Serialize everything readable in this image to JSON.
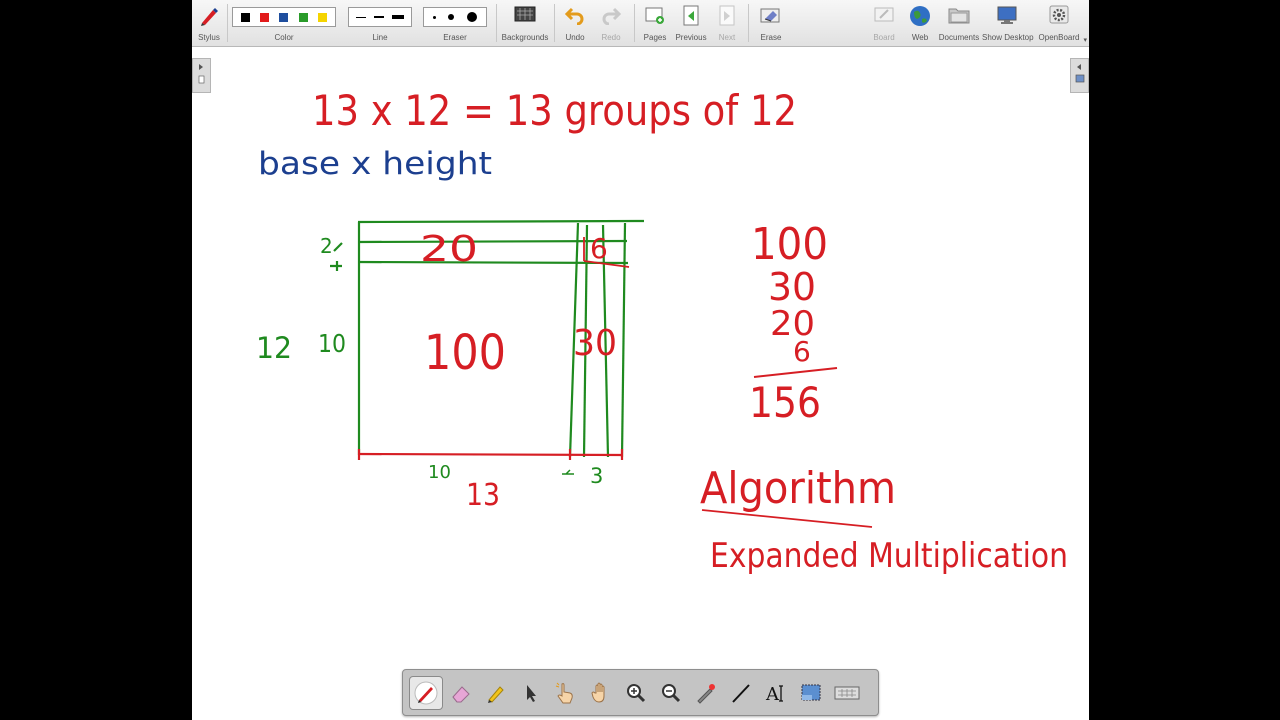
{
  "toolbar": {
    "stylus": "Stylus",
    "color": "Color",
    "line": "Line",
    "eraser": "Eraser",
    "backgrounds": "Backgrounds",
    "undo": "Undo",
    "redo": "Redo",
    "pages": "Pages",
    "previous": "Previous",
    "next": "Next",
    "erase": "Erase",
    "board": "Board",
    "web": "Web",
    "documents": "Documents",
    "show_desktop": "Show Desktop",
    "openboard": "OpenBoard"
  },
  "colors": {
    "swatches": [
      "#000000",
      "#e21b1b",
      "#1f4e9e",
      "#2a9b2a",
      "#f5d400"
    ],
    "ink_red": "#d61e24",
    "ink_blue": "#1c3f8f",
    "ink_green": "#1f8a1f"
  },
  "board": {
    "line1": "13 x 12 = 13 groups of 12",
    "line2": "base x height",
    "row_label_2": "2",
    "row_label_12": "12",
    "row_label_10": "10",
    "cell_20": "20",
    "cell_6": "6",
    "cell_100": "100",
    "cell_30": "30",
    "bottom_10": "10",
    "bottom_3": "3",
    "bottom_13": "13",
    "sum": [
      "100",
      "30",
      "20",
      "6"
    ],
    "total": "156",
    "algorithm": "Algorithm",
    "expanded": "Expanded Multiplication"
  },
  "palette_tools": [
    "pen-tool",
    "eraser-tool",
    "marker-tool",
    "selector-tool",
    "interact-tool",
    "hand-tool",
    "zoom-in-tool",
    "zoom-out-tool",
    "laser-pointer-tool",
    "line-tool",
    "text-tool",
    "capture-tool",
    "virtual-keyboard"
  ]
}
